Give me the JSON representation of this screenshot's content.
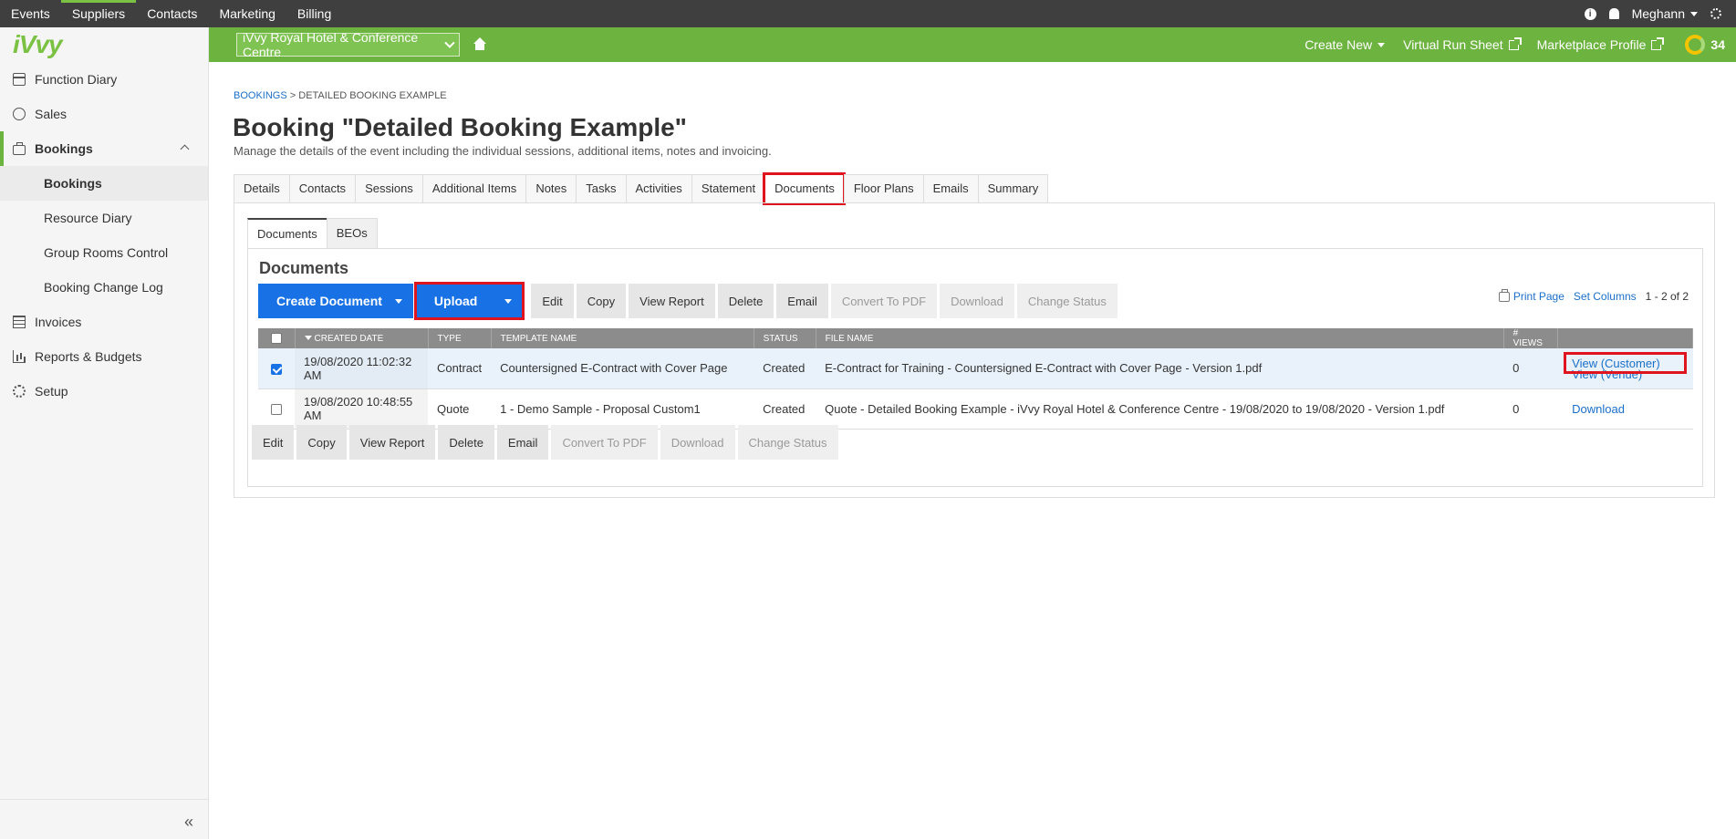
{
  "topnav": {
    "items": [
      {
        "label": "Events"
      },
      {
        "label": "Suppliers"
      },
      {
        "label": "Contacts"
      },
      {
        "label": "Marketing"
      },
      {
        "label": "Billing"
      }
    ],
    "user": "Meghann"
  },
  "greenbar": {
    "venue": "iVvy Royal Hotel & Conference Centre",
    "create_new": "Create New",
    "virtual_run_sheet": "Virtual Run Sheet",
    "marketplace_profile": "Marketplace Profile",
    "score": "34"
  },
  "sidebar": {
    "logo": "iVvy",
    "items": [
      {
        "label": "Function Diary",
        "icon": "calendar-icon"
      },
      {
        "label": "Sales",
        "icon": "sales-icon"
      },
      {
        "label": "Bookings",
        "icon": "briefcase-icon"
      },
      {
        "label": "Invoices",
        "icon": "invoice-icon"
      },
      {
        "label": "Reports & Budgets",
        "icon": "chart-icon"
      },
      {
        "label": "Setup",
        "icon": "gear-icon"
      }
    ],
    "sub_items": [
      {
        "label": "Bookings"
      },
      {
        "label": "Resource Diary"
      },
      {
        "label": "Group Rooms Control"
      },
      {
        "label": "Booking Change Log"
      }
    ],
    "collapse": "«"
  },
  "breadcrumb": {
    "root": "BOOKINGS",
    "sep": ">",
    "current": "DETAILED BOOKING EXAMPLE"
  },
  "page": {
    "title": "Booking \"Detailed Booking Example\"",
    "subtitle": "Manage the details of the event including the individual sessions, additional items, notes and invoicing."
  },
  "tabs": [
    "Details",
    "Contacts",
    "Sessions",
    "Additional Items",
    "Notes",
    "Tasks",
    "Activities",
    "Statement",
    "Documents",
    "Floor Plans",
    "Emails",
    "Summary"
  ],
  "subtabs": [
    "Documents",
    "BEOs"
  ],
  "documents": {
    "heading": "Documents",
    "create_document": "Create Document",
    "upload": "Upload",
    "buttons": [
      "Edit",
      "Copy",
      "View Report",
      "Delete",
      "Email",
      "Convert To PDF",
      "Download",
      "Change Status"
    ],
    "print_page": "Print Page",
    "set_columns": "Set Columns",
    "count": "1 - 2 of 2",
    "columns": [
      "Created Date",
      "Type",
      "Template Name",
      "Status",
      "File Name",
      "# Views"
    ],
    "rows": [
      {
        "created": "19/08/2020 11:02:32 AM",
        "type": "Contract",
        "template": "Countersigned E-Contract with Cover Page",
        "status": "Created",
        "file": "E-Contract for Training - Countersigned E-Contract with Cover Page - Version 1.pdf",
        "views": "0",
        "action1": "View (Customer)",
        "action2": "View (Venue)"
      },
      {
        "created": "19/08/2020 10:48:55 AM",
        "type": "Quote",
        "template": "1 - Demo Sample - Proposal Custom1",
        "status": "Created",
        "file": "Quote - Detailed Booking Example - iVvy Royal Hotel & Conference Centre - 19/08/2020 to 19/08/2020 - Version 1.pdf",
        "views": "0",
        "action1": "Download"
      }
    ]
  },
  "colors": {
    "topbar": "#3f3f3f",
    "green": "#6db33f",
    "primary": "#1971e6",
    "highlight": "#e0141e"
  }
}
